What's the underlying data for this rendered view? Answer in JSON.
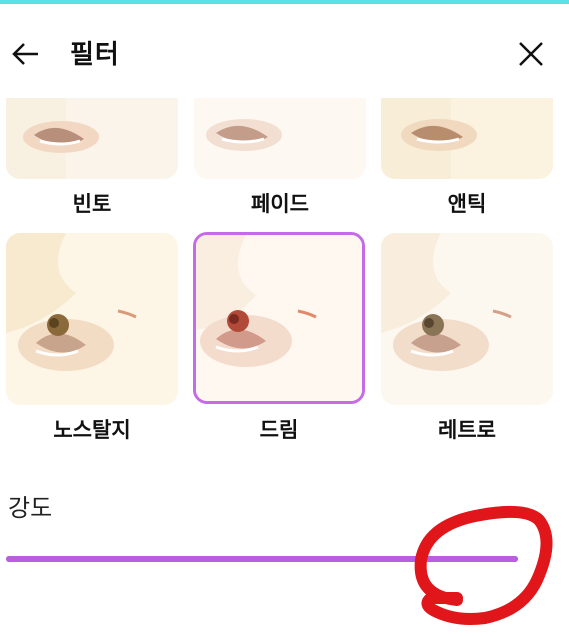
{
  "header": {
    "title": "필터",
    "back_icon": "arrow-left-icon",
    "close_icon": "close-icon"
  },
  "filters": [
    {
      "label": "빈토",
      "selected": false
    },
    {
      "label": "페이드",
      "selected": false
    },
    {
      "label": "앤틱",
      "selected": false
    },
    {
      "label": "노스탈지",
      "selected": false
    },
    {
      "label": "드림",
      "selected": true
    },
    {
      "label": "레트로",
      "selected": false
    }
  ],
  "intensity": {
    "label": "강도",
    "value_fraction": 1.0
  },
  "colors": {
    "accent": "#c56be6",
    "slider": "#b85fe0",
    "annotation": "#e0161a",
    "top_bar": "#5ee0e8"
  }
}
